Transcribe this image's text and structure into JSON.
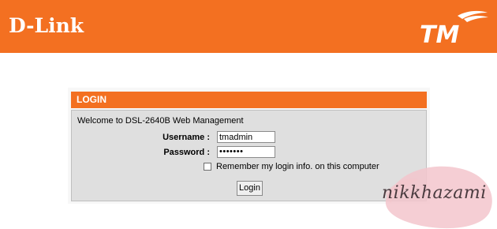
{
  "header": {
    "brand": "D-Link",
    "partner_logo_text": "TM",
    "background_color": "#f37021"
  },
  "login": {
    "title": "LOGIN",
    "welcome": "Welcome to DSL-2640B Web Management",
    "username_label": "Username :",
    "username_value": "tmadmin",
    "password_label": "Password :",
    "password_value": "•••••••",
    "remember_label": "Remember my login info. on this computer",
    "remember_checked": false,
    "button_label": "Login"
  },
  "watermark": {
    "text": "nikkhazami",
    "blob_color": "#f3c6cc"
  }
}
